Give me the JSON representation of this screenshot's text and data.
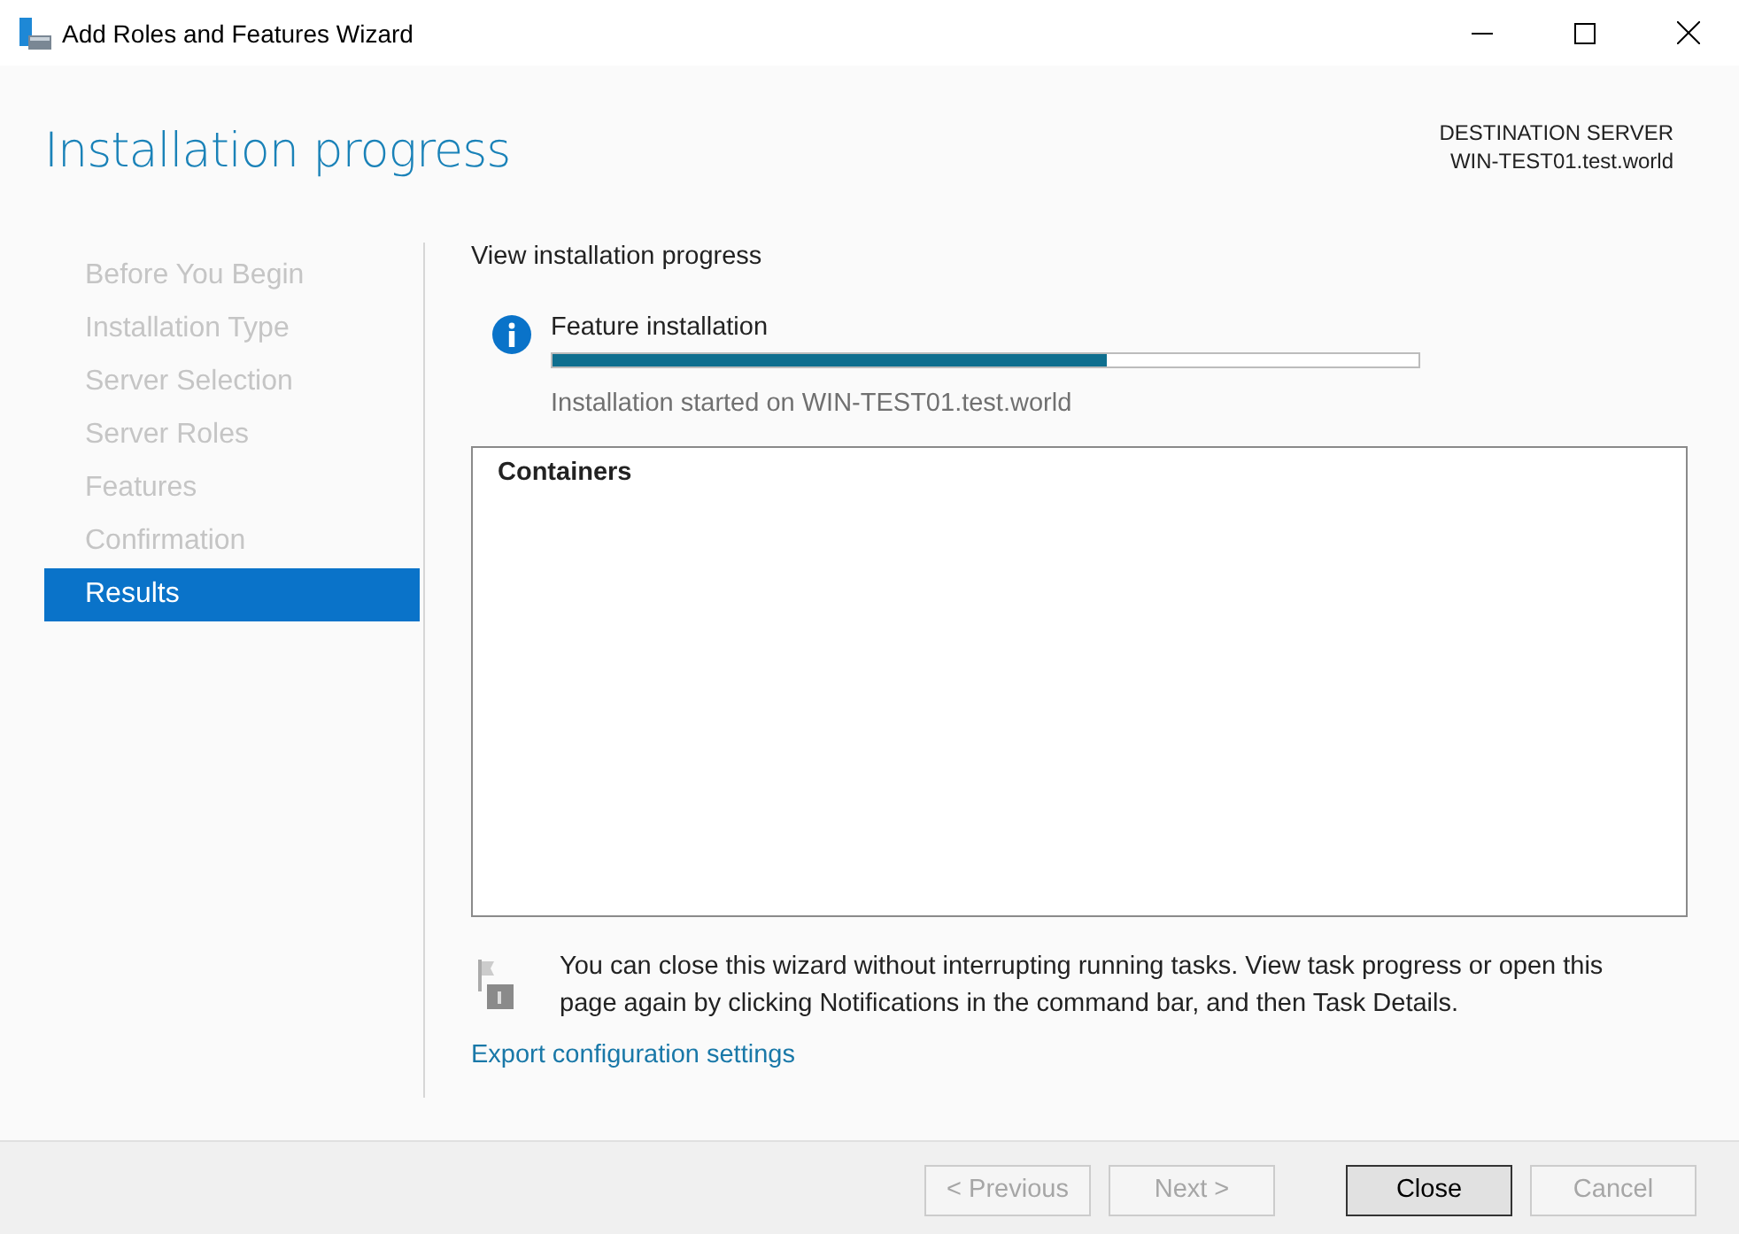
{
  "window": {
    "title": "Add Roles and Features Wizard"
  },
  "page_title": "Installation progress",
  "destination": {
    "label": "DESTINATION SERVER",
    "server": "WIN-TEST01.test.world"
  },
  "steps": [
    {
      "label": "Before You Begin",
      "selected": false
    },
    {
      "label": "Installation Type",
      "selected": false
    },
    {
      "label": "Server Selection",
      "selected": false
    },
    {
      "label": "Server Roles",
      "selected": false
    },
    {
      "label": "Features",
      "selected": false
    },
    {
      "label": "Confirmation",
      "selected": false
    },
    {
      "label": "Results",
      "selected": true
    }
  ],
  "section_title": "View installation progress",
  "progress": {
    "title": "Feature installation",
    "level": 0.64,
    "status": "Installation started on WIN-TEST01.test.world"
  },
  "results_list": [
    "Containers"
  ],
  "notice": "You can close this wizard without interrupting running tasks. View task progress or open this page again by clicking Notifications in the command bar, and then Task Details.",
  "export_link": "Export configuration settings",
  "buttons": [
    {
      "label": "< Previous",
      "disabled": true,
      "default": false
    },
    {
      "label": "Next >",
      "disabled": true,
      "default": false
    },
    {
      "label": "Close",
      "disabled": false,
      "default": true
    },
    {
      "label": "Cancel",
      "disabled": true,
      "default": false
    }
  ]
}
